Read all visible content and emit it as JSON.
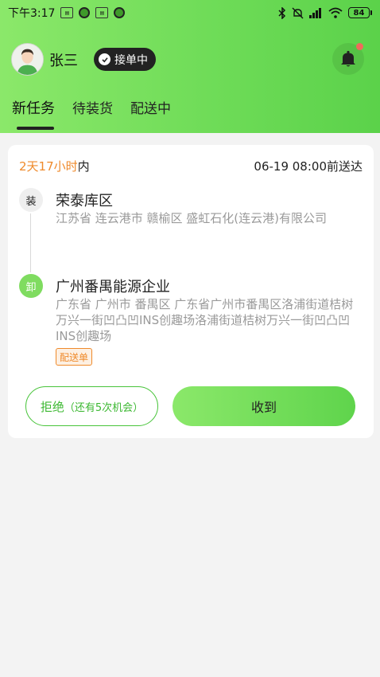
{
  "status_bar": {
    "time": "下午3:17",
    "battery": "84"
  },
  "profile": {
    "name": "张三",
    "status_label": "接单中"
  },
  "tabs": [
    {
      "label": "新任务",
      "active": true
    },
    {
      "label": "待装货",
      "active": false
    },
    {
      "label": "配送中",
      "active": false
    }
  ],
  "order": {
    "time_limit_highlight": "2天17小时",
    "time_limit_suffix": "内",
    "deliver_by": "06-19 08:00前送达",
    "pickup": {
      "badge": "装",
      "name": "荣泰库区",
      "address": "江苏省 连云港市 赣榆区 盛虹石化(连云港)有限公司"
    },
    "dropoff": {
      "badge": "卸",
      "name": "广州番禺能源企业",
      "address": "广东省 广州市 番禺区 广东省广州市番禺区洛浦街道桔树万兴一街凹凸凹INS创趣场洛浦街道桔树万兴一街凹凸凹INS创趣场"
    },
    "tag": "配送单",
    "reject_label": "拒绝",
    "reject_hint": "（还有5次机会）",
    "accept_label": "收到"
  },
  "colors": {
    "brand_green": "#6fdc58",
    "accent_orange": "#ef8a2b",
    "notification_dot": "#f06a5c"
  }
}
